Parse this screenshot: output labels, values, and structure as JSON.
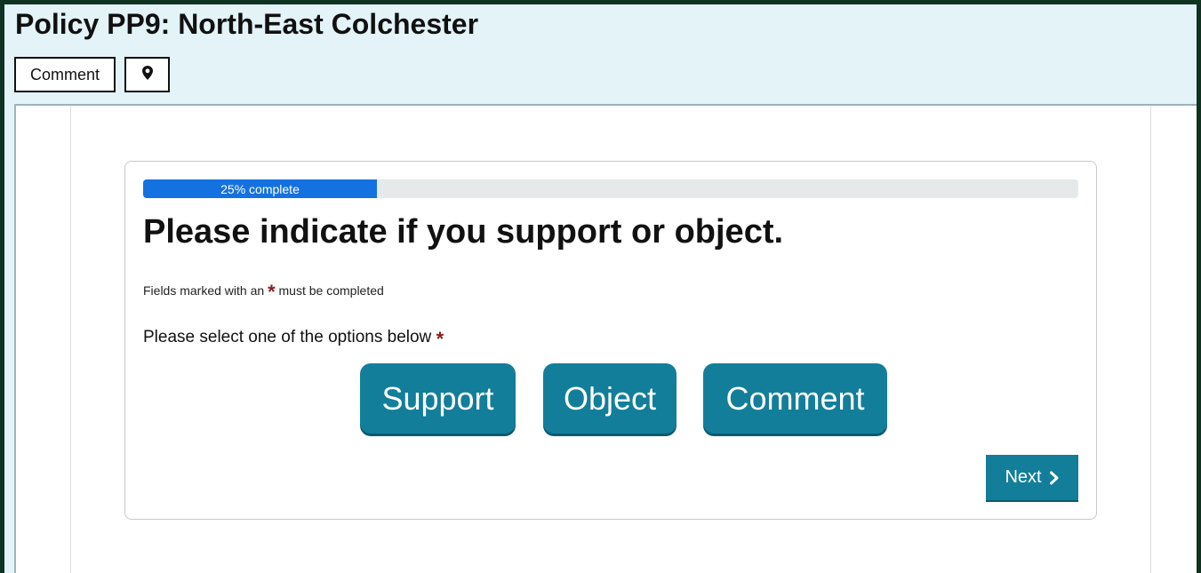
{
  "header": {
    "title": "Policy PP9: North-East Colchester",
    "comment_label": "Comment",
    "location_icon": "map-pin-icon"
  },
  "form": {
    "progress": {
      "percent": 25,
      "label": "25% complete"
    },
    "heading": "Please indicate if you support or object.",
    "required_note_prefix": "Fields marked with an",
    "required_note_suffix": "must be completed",
    "required_marker": "*",
    "prompt": "Please select one of the options below",
    "options": [
      {
        "label": "Support"
      },
      {
        "label": "Object"
      },
      {
        "label": "Comment"
      }
    ],
    "next_label": "Next",
    "next_icon": "chevron-right-icon"
  },
  "colors": {
    "accent": "#137e9a",
    "progress": "#1471e0",
    "required": "#8b1a1a",
    "header_bg": "#e3f3f8"
  }
}
